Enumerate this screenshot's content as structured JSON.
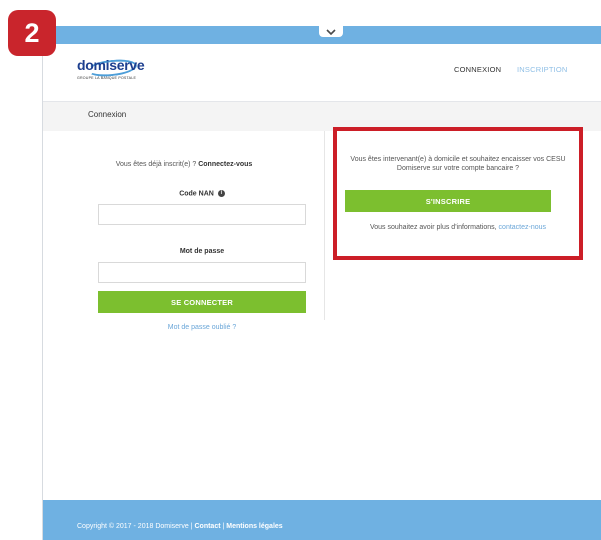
{
  "step_number": "2",
  "logo": {
    "text": "domiserve",
    "tagline": "GROUPE LA BANQUE POSTALE"
  },
  "nav": {
    "connexion": "CONNEXION",
    "inscription": "INSCRIPTION"
  },
  "breadcrumb": "Connexion",
  "login": {
    "lead_prefix": "Vous êtes déjà inscrit(e) ? ",
    "lead_bold": "Connectez-vous",
    "code_label": "Code NAN",
    "code_value": "",
    "password_label": "Mot de passe",
    "password_value": "",
    "submit_label": "SE CONNECTER",
    "forgot_label": "Mot de passe oublié ?"
  },
  "signup": {
    "intro": "Vous êtes intervenant(e) à domicile et souhaitez encaisser vos CESU Domiserve sur votre compte bancaire ?",
    "button_label": "S'INSCRIRE",
    "more_prefix": "Vous souhaitez avoir plus d'informations, ",
    "more_link": "contactez-nous"
  },
  "footer": {
    "copyright": "Copyright © 2017 - 2018 Domiserve | ",
    "contact": "Contact",
    "separator": " | ",
    "legal": "Mentions légales"
  },
  "colors": {
    "accent_blue": "#6fb1e2",
    "green": "#7cbf2f",
    "highlight_red": "#cc1e27",
    "badge_red": "#c9252c"
  },
  "icons": {
    "top_tab": "chevron-down-icon",
    "code_info": "info-icon"
  }
}
